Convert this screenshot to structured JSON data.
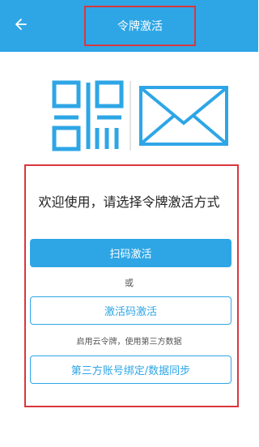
{
  "header": {
    "title": "令牌激活",
    "back_icon": "arrow-left-icon"
  },
  "hero": {
    "icons": [
      "qr-code-icon",
      "envelope-icon"
    ]
  },
  "main": {
    "welcome": "欢迎使用，请选择令牌激活方式",
    "scan_button": "扫码激活",
    "or_text": "或",
    "code_button": "激活码激活",
    "cloud_hint": "启用云令牌，使用第三方数据",
    "third_party_button": "第三方账号绑定/数据同步"
  },
  "colors": {
    "accent": "#2ea6e6",
    "highlight_border": "#d9363e"
  }
}
